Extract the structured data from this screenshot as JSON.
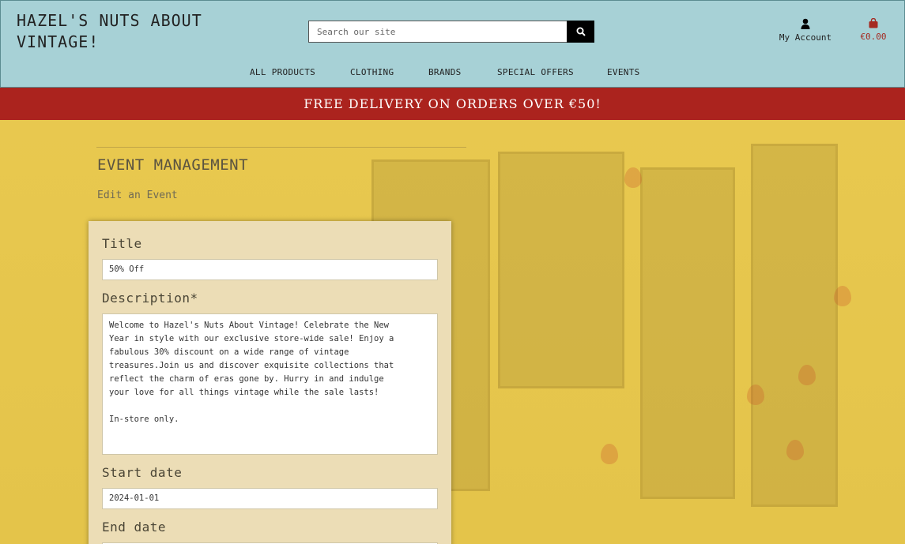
{
  "header": {
    "brand": "HAZEL'S NUTS ABOUT VINTAGE!",
    "search_placeholder": "Search our site",
    "account_label": "My Account",
    "bag_total": "€0.00"
  },
  "nav": [
    "ALL PRODUCTS",
    "CLOTHING",
    "BRANDS",
    "SPECIAL OFFERS",
    "EVENTS"
  ],
  "banner": "FREE DELIVERY ON ORDERS OVER €50!",
  "page": {
    "title": "EVENT MANAGEMENT",
    "subtitle": "Edit an Event"
  },
  "form": {
    "title_label": "Title",
    "title_value": "50% Off",
    "description_label": "Description*",
    "description_value": "Welcome to Hazel's Nuts About Vintage! Celebrate the New\nYear in style with our exclusive store-wide sale! Enjoy a\nfabulous 30% discount on a wide range of vintage\ntreasures.Join us and discover exquisite collections that\nreflect the charm of eras gone by. Hurry in and indulge\nyour love for all things vintage while the sale lasts!\n\nIn-store only.",
    "start_label": "Start date",
    "start_value": "2024-01-01",
    "end_label": "End date",
    "end_value": ""
  },
  "colors": {
    "header_bg": "#a7d1d6",
    "banner_bg": "#ab231e",
    "card_bg": "#ecddb6",
    "page_bg": "#e6c74e"
  },
  "icons": {
    "search": "search-icon",
    "account": "user-icon",
    "bag": "shopping-bag-icon"
  }
}
